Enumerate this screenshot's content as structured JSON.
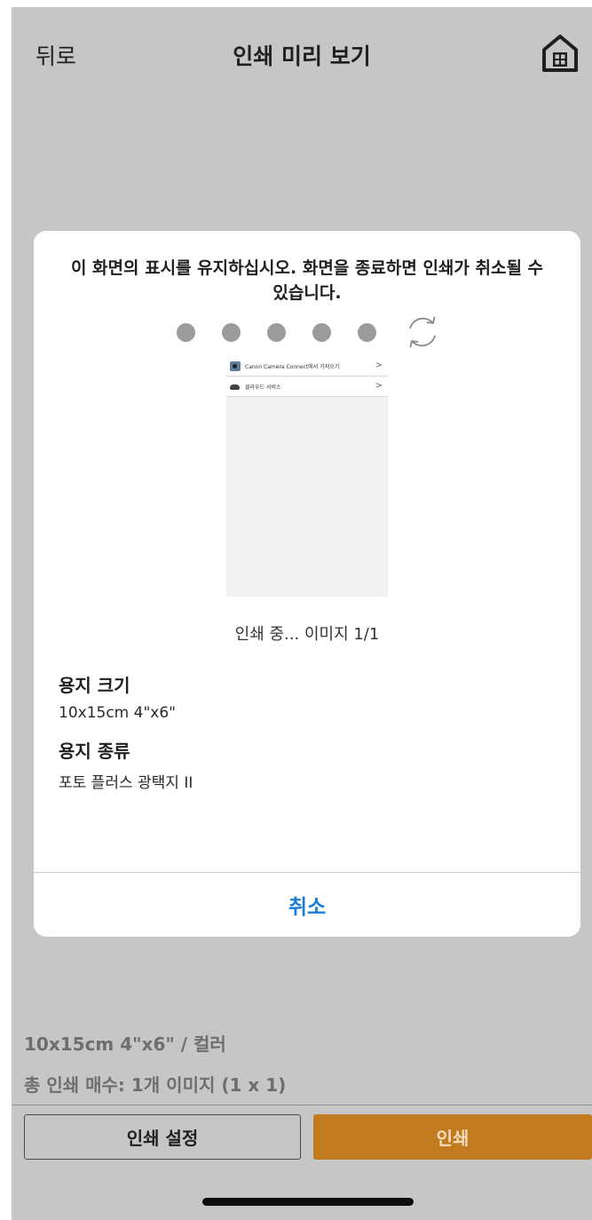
{
  "header": {
    "back_label": "뒤로",
    "title": "인쇄 미리 보기",
    "home_icon": "home-icon"
  },
  "dialog": {
    "message": "이 화면의 표시를 유지하십시오. 화면을 종료하면 인쇄가 취소될 수 있습니다.",
    "progress_dots": 5,
    "refresh_icon": "refresh-icon",
    "preview": {
      "row1_text": "Canon Camera Connect에서 가져오기",
      "row2_text": "클라우드 서비스",
      "chevron": ">"
    },
    "status": "인쇄 중... 이미지 1/1",
    "paper_size_label": "용지 크기",
    "paper_size_value": "10x15cm 4\"x6\"",
    "paper_type_label": "용지 종류",
    "paper_type_value": "포토 플러스 광택지 II",
    "cancel_label": "취소"
  },
  "footer": {
    "summary_line": "10x15cm 4\"x6\" / 컬러",
    "total_line": "총 인쇄 매수: 1개 이미지 (1 x 1)",
    "settings_label": "인쇄 설정",
    "print_label": "인쇄"
  },
  "colors": {
    "background": "#c6c6c6",
    "accent_orange": "#c17b1e",
    "link_blue": "#1a7ed8",
    "dot_gray": "#9b9b9b"
  }
}
